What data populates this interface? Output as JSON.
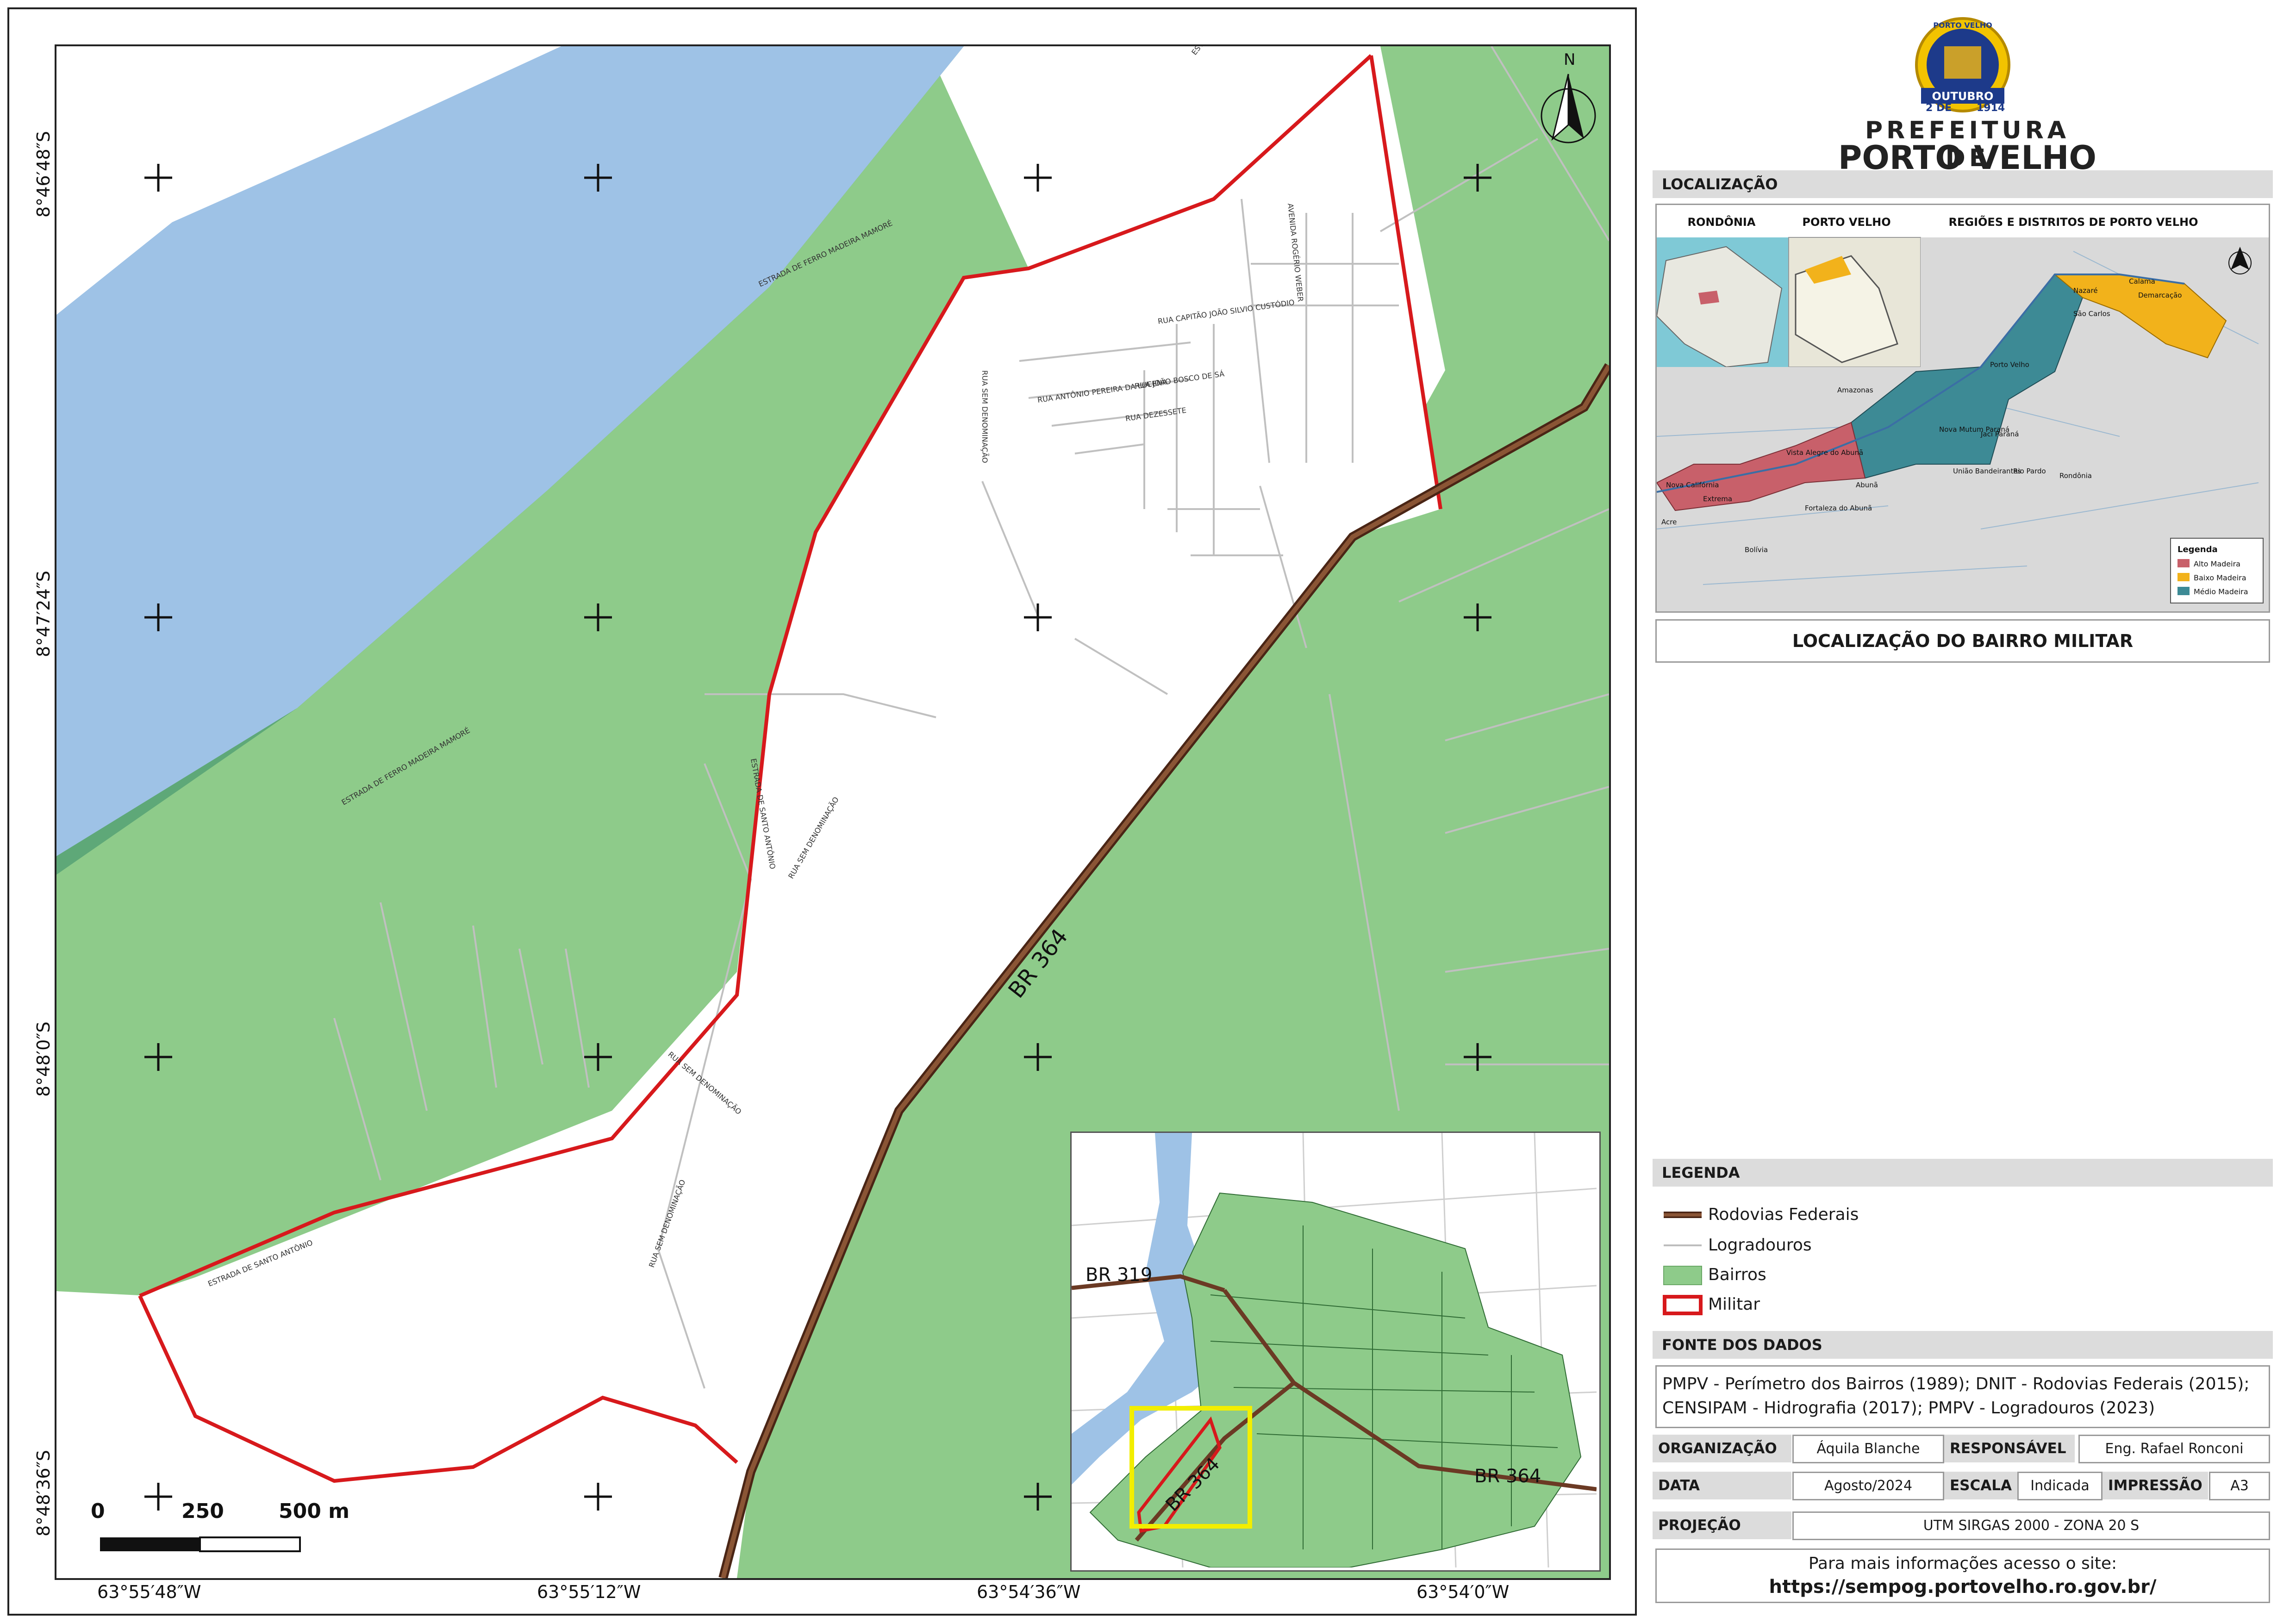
{
  "map": {
    "road_label": "BR 364",
    "north_label": "N",
    "lat_labels": [
      "8°46′48″S",
      "8°47′24″S",
      "8°48′0″S",
      "8°48′36″S"
    ],
    "lon_labels": [
      "63°55′48″W",
      "63°55′12″W",
      "63°54′36″W",
      "63°54′0″W"
    ],
    "scale_labels": [
      "0",
      "250",
      "500 m"
    ],
    "street_labels": [
      "ESTRADA DE SANTO ANTÔNIO",
      "RUA SEM DENOMINAÇÃO",
      "RUA CAPITÃO JOÃO SILVIO CUSTÓDIO",
      "RUA ANTÔNIO PEREIRA DA LUCENA",
      "RUA JOÃO BOSCO DE SÁ",
      "RUA DEZESSETE",
      "AVENIDA ROGÉRIO WEBER",
      "ESTRADA DE FERRO MADEIRA MAMORÉ"
    ],
    "colors": {
      "river": "#9ec2e6",
      "riverbank": "#5ea878",
      "bairros": "#8ecb8a",
      "road": "#6b3a24",
      "boundary": "#d7191c",
      "logradouro": "#c8c8c8"
    }
  },
  "inset": {
    "road_labels": [
      "BR 319",
      "BR 364"
    ]
  },
  "logo": {
    "badge_top": "PORTO VELHO",
    "badge_date": "2 DE",
    "badge_month": "OUTUBRO",
    "badge_year": "1914",
    "line1": "PREFEITURA DE",
    "line2": "PORTO VELHO"
  },
  "localizacao": {
    "header": "LOCALIZAÇÃO",
    "panel_titles": [
      "RONDÔNIA",
      "PORTO VELHO",
      "REGIÕES E DISTRITOS DE PORTO VELHO"
    ],
    "place_labels": [
      "Amazonas",
      "Acre",
      "Bolívia",
      "Rondônia",
      "Nova Califórnia",
      "Extrema",
      "Vista Alegre do Abunã",
      "Fortaleza do Abunã",
      "Abunã",
      "Nova Mutum Paraná",
      "Jaci Paraná",
      "União Bandeirantes",
      "Rio Pardo",
      "Porto Velho",
      "Nazaré",
      "Calama",
      "Demarcação",
      "São Carlos"
    ],
    "legend_title": "Legenda",
    "legend_items": [
      {
        "label": "Alto Madeira",
        "color": "#c8606a"
      },
      {
        "label": "Baixo Madeira",
        "color": "#f2b21b"
      },
      {
        "label": "Médio Madeira",
        "color": "#3d8a95"
      }
    ],
    "caption": "LOCALIZAÇÃO DO BAIRRO MILITAR"
  },
  "legenda": {
    "header": "LEGENDA",
    "items": [
      {
        "label": "Rodovias Federais",
        "icon": "federal-road-line"
      },
      {
        "label": "Logradouros",
        "icon": "street-line"
      },
      {
        "label": "Bairros",
        "icon": "green-fill"
      },
      {
        "label": "Militar",
        "icon": "red-outline"
      }
    ]
  },
  "fonte": {
    "header": "FONTE DOS DADOS",
    "text": "PMPV - Perímetro dos Bairros (1989); DNIT - Rodovias Federais (2015); CENSIPAM - Hidrografia (2017); PMPV - Logradouros (2023)"
  },
  "meta": {
    "organizacao_label": "ORGANIZAÇÃO",
    "organizacao": "Áquila Blanche",
    "responsavel_label": "RESPONSÁVEL",
    "responsavel": "Eng. Rafael Ronconi",
    "data_label": "DATA",
    "data": "Agosto/2024",
    "escala_label": "ESCALA",
    "escala": "Indicada",
    "impressao_label": "IMPRESSÃO",
    "impressao": "A3",
    "projecao_label": "PROJEÇÃO",
    "projecao": "UTM SIRGAS 2000 - ZONA 20 S"
  },
  "footer": {
    "line1": "Para mais informações acesso o site:",
    "line2": "https://sempog.portovelho.ro.gov.br/"
  }
}
